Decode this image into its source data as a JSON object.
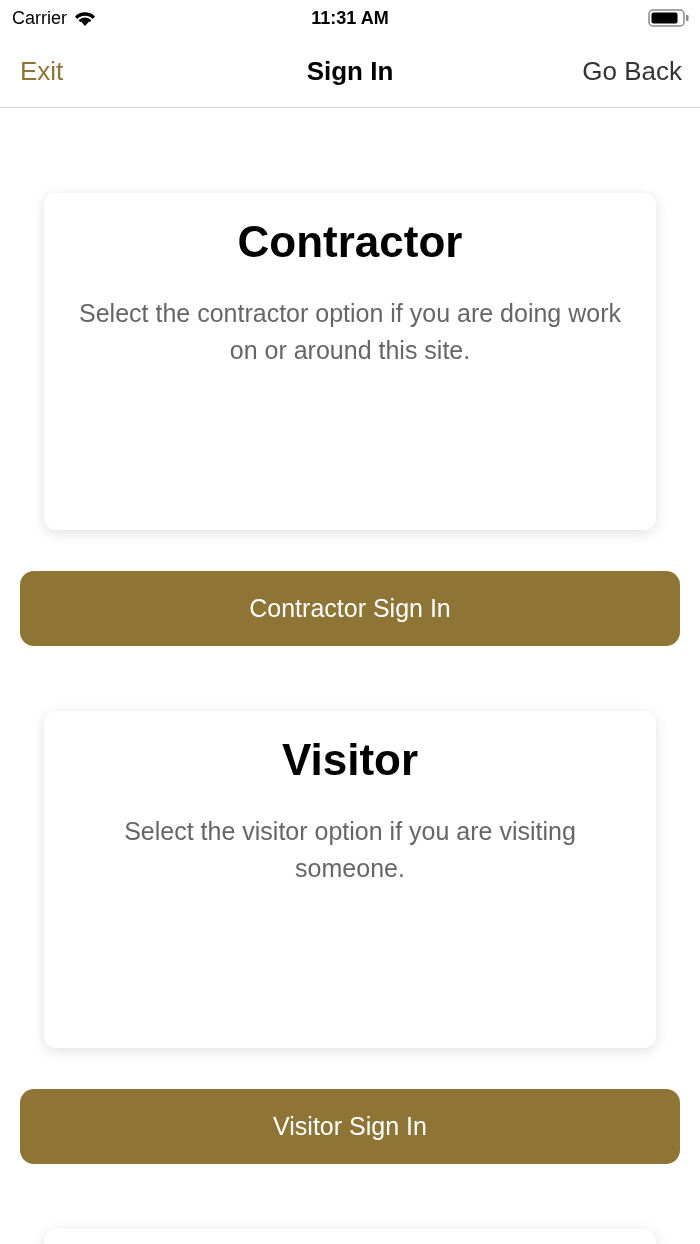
{
  "status_bar": {
    "carrier": "Carrier",
    "time": "11:31 AM"
  },
  "nav": {
    "left": "Exit",
    "title": "Sign In",
    "right": "Go Back"
  },
  "options": [
    {
      "title": "Contractor",
      "description": "Select the contractor option if you are doing work on or around this site.",
      "button": "Contractor Sign In"
    },
    {
      "title": "Visitor",
      "description": "Select the visitor option if you are visiting someone.",
      "button": "Visitor Sign In"
    }
  ]
}
